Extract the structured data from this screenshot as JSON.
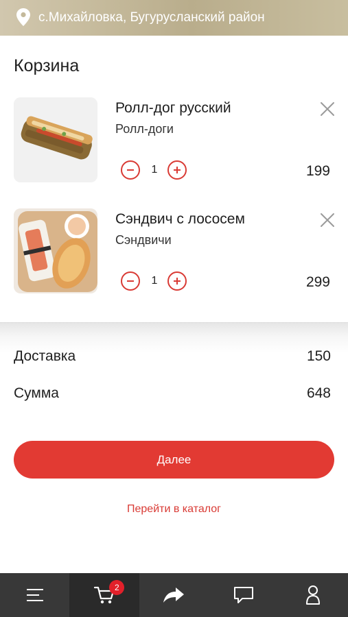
{
  "header": {
    "location": "с.Михайловка, Бугурусланский район"
  },
  "cart": {
    "title": "Корзина",
    "items": [
      {
        "name": "Ролл-дог русский",
        "category": "Ролл-доги",
        "quantity": "1",
        "price": "199"
      },
      {
        "name": "Сэндвич с лососем",
        "category": "Сэндвичи",
        "quantity": "1",
        "price": "299"
      }
    ]
  },
  "summary": {
    "delivery_label": "Доставка",
    "delivery_value": "150",
    "total_label": "Сумма",
    "total_value": "648"
  },
  "actions": {
    "next_label": "Далее",
    "catalog_label": "Перейти в каталог"
  },
  "tabbar": {
    "tabs": [
      {
        "icon": "menu-icon"
      },
      {
        "icon": "cart-icon",
        "badge": "2",
        "active": true
      },
      {
        "icon": "share-icon"
      },
      {
        "icon": "chat-icon"
      },
      {
        "icon": "profile-icon"
      }
    ]
  },
  "colors": {
    "accent": "#e23a33",
    "tabbar": "#383838",
    "header": "#c7bc9e"
  }
}
